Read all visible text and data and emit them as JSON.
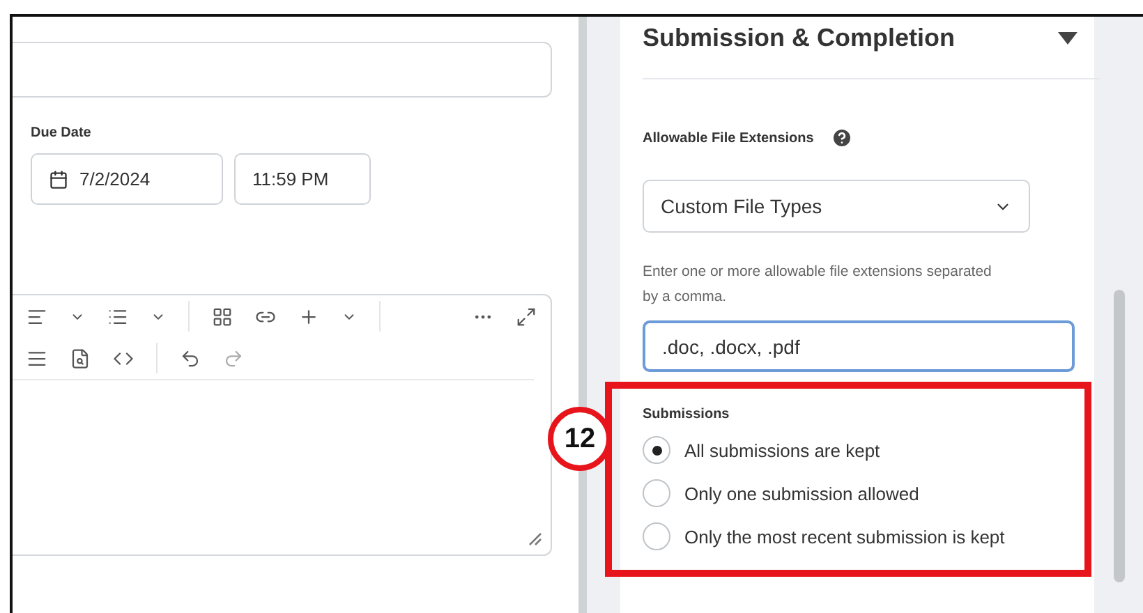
{
  "due_date": {
    "label": "Due Date",
    "date": "7/2/2024",
    "time": "11:59 PM"
  },
  "panel": {
    "title": "Submission & Completion",
    "expanded": true,
    "extensions": {
      "label": "Allowable File Extensions",
      "select": "Custom File Types",
      "hint": "Enter one or more allowable file extensions separated by a comma.",
      "value": ".doc, .docx, .pdf"
    },
    "submissions": {
      "label": "Submissions",
      "badge": "12",
      "options": [
        {
          "label": "All submissions are kept",
          "selected": true
        },
        {
          "label": "Only one submission allowed",
          "selected": false
        },
        {
          "label": "Only the most recent submission is kept",
          "selected": false
        }
      ]
    }
  }
}
